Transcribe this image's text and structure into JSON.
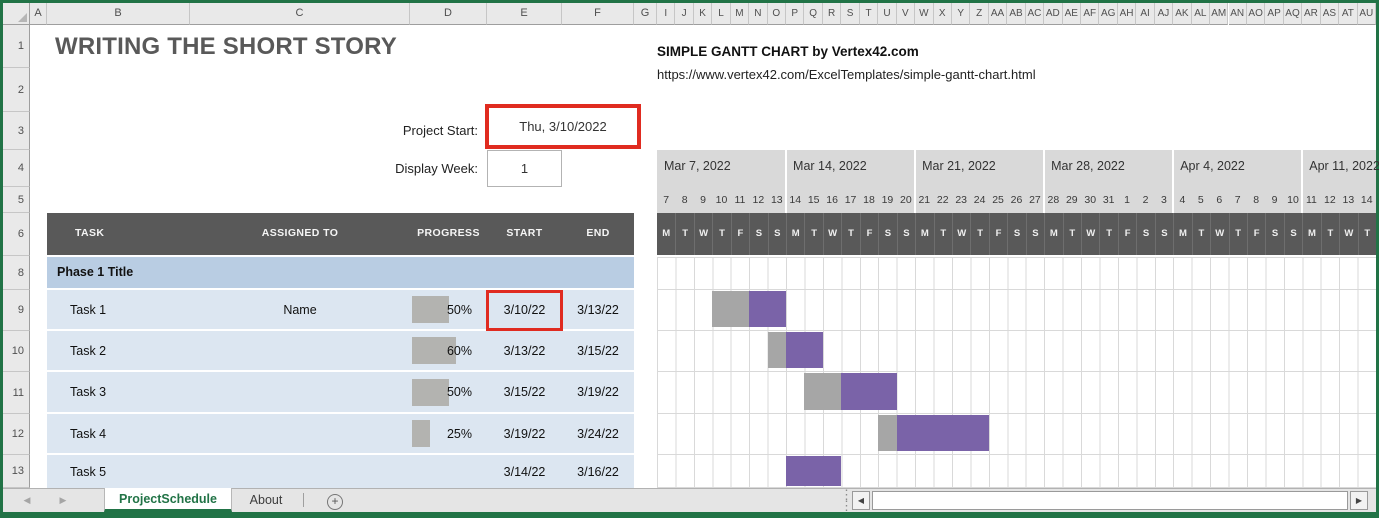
{
  "header": {
    "title": "WRITING THE SHORT STORY",
    "brand": "SIMPLE GANTT CHART by Vertex42.com",
    "url": "https://www.vertex42.com/ExcelTemplates/simple-gantt-chart.html"
  },
  "controls": {
    "project_start_label": "Project Start:",
    "project_start_value": "Thu, 3/10/2022",
    "display_week_label": "Display Week:",
    "display_week_value": "1"
  },
  "spreadsheet": {
    "column_letters": [
      "A",
      "B",
      "C",
      "D",
      "E",
      "F",
      "G"
    ],
    "day_column_letters": [
      "I",
      "J",
      "K",
      "L",
      "M",
      "N",
      "O",
      "P",
      "Q",
      "R",
      "S",
      "T",
      "U",
      "V",
      "W",
      "X",
      "Y",
      "Z",
      "AA",
      "AB",
      "AC",
      "AD",
      "AE",
      "AF",
      "AG",
      "AH",
      "AI",
      "AJ",
      "AK",
      "AL",
      "AM",
      "AN",
      "AO",
      "AP",
      "AQ",
      "AR",
      "AS",
      "AT",
      "AU"
    ],
    "row_numbers": [
      "1",
      "2",
      "3",
      "4",
      "5",
      "6",
      "8",
      "9",
      "10",
      "11",
      "12",
      "13"
    ]
  },
  "table": {
    "headers": [
      "TASK",
      "ASSIGNED TO",
      "PROGRESS",
      "START",
      "END"
    ],
    "phase_title": "Phase 1 Title"
  },
  "tasks": [
    {
      "name": "Task 1",
      "assigned": "Name",
      "progress": "50%",
      "pct": 50,
      "start": "3/10/22",
      "end": "3/13/22",
      "start_highlighted": true,
      "bar": {
        "gray": [
          3,
          2
        ],
        "purple": [
          5,
          2
        ]
      }
    },
    {
      "name": "Task 2",
      "assigned": "",
      "progress": "60%",
      "pct": 60,
      "start": "3/13/22",
      "end": "3/15/22",
      "bar": {
        "gray": [
          6,
          1
        ],
        "purple": [
          7,
          2
        ]
      }
    },
    {
      "name": "Task 3",
      "assigned": "",
      "progress": "50%",
      "pct": 50,
      "start": "3/15/22",
      "end": "3/19/22",
      "bar": {
        "gray": [
          8,
          2
        ],
        "purple": [
          10,
          3
        ]
      }
    },
    {
      "name": "Task 4",
      "assigned": "",
      "progress": "25%",
      "pct": 25,
      "start": "3/19/22",
      "end": "3/24/22",
      "bar": {
        "gray": [
          12,
          1
        ],
        "purple": [
          13,
          5
        ]
      }
    },
    {
      "name": "Task 5",
      "assigned": "",
      "progress": "",
      "pct": 0,
      "start": "3/14/22",
      "end": "3/16/22",
      "bar": {
        "purple": [
          7,
          3
        ]
      }
    }
  ],
  "gantt": {
    "weeks": [
      {
        "label": "Mar 7, 2022",
        "days": [
          "7",
          "8",
          "9",
          "10",
          "11",
          "12",
          "13"
        ]
      },
      {
        "label": "Mar 14, 2022",
        "days": [
          "14",
          "15",
          "16",
          "17",
          "18",
          "19",
          "20"
        ]
      },
      {
        "label": "Mar 21, 2022",
        "days": [
          "21",
          "22",
          "23",
          "24",
          "25",
          "26",
          "27"
        ]
      },
      {
        "label": "Mar 28, 2022",
        "days": [
          "28",
          "29",
          "30",
          "31",
          "1",
          "2",
          "3"
        ]
      },
      {
        "label": "Apr 4, 2022",
        "days": [
          "4",
          "5",
          "6",
          "7",
          "8",
          "9",
          "10"
        ]
      },
      {
        "label": "Apr 11, 2022",
        "days": [
          "11",
          "12",
          "13",
          "14"
        ]
      }
    ],
    "day_letters": [
      "M",
      "T",
      "W",
      "T",
      "F",
      "S",
      "S",
      "M",
      "T",
      "W",
      "T",
      "F",
      "S",
      "S",
      "M",
      "T",
      "W",
      "T",
      "F",
      "S",
      "S",
      "M",
      "T",
      "W",
      "T",
      "F",
      "S",
      "S",
      "M",
      "T",
      "W",
      "T",
      "F",
      "S",
      "S",
      "M",
      "T",
      "W",
      "T"
    ]
  },
  "tabs": {
    "active": "ProjectSchedule",
    "about": "About",
    "new_sheet": "+"
  },
  "colors": {
    "excel-green": "#217346",
    "header-dark": "#595959",
    "phase-fill": "#b9cde3",
    "task-fill": "#dce6f1",
    "bar-purple": "#7a63a8",
    "bar-gray": "#a6a6a6",
    "progress-gray": "#b3b3b0",
    "band-gray": "#d9d9d9",
    "highlight-red": "#e02b20"
  }
}
